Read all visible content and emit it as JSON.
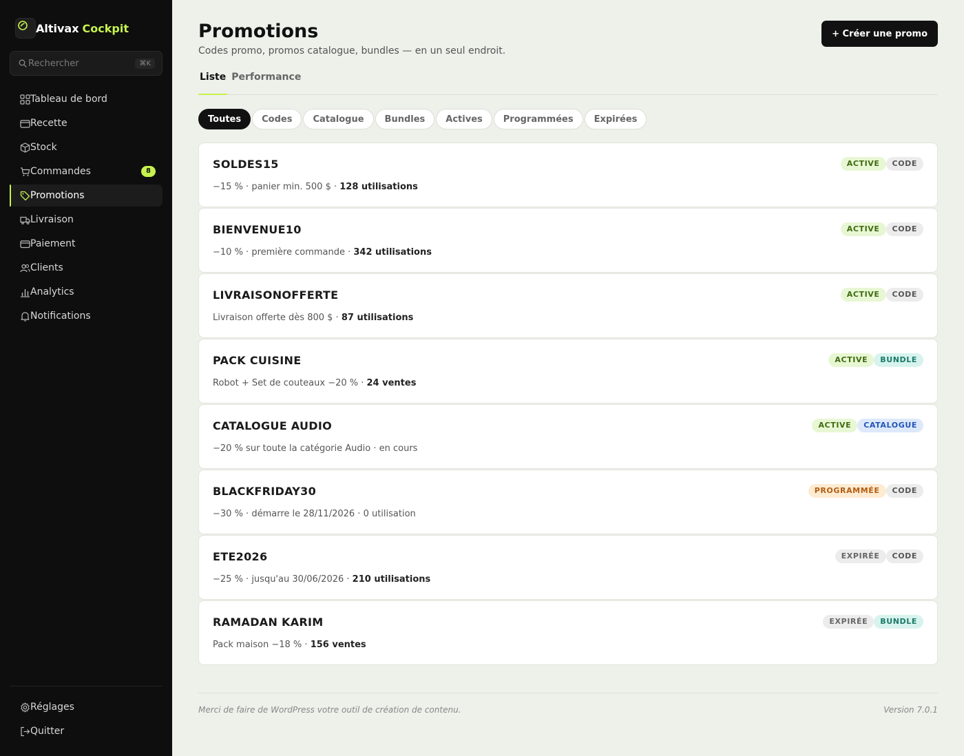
{
  "brand": {
    "name": "Altivax",
    "accent": "Cockpit",
    "icon": "gauge-icon",
    "accent_color": "#c6f24e"
  },
  "search": {
    "placeholder": "Rechercher",
    "shortcut": "⌘K"
  },
  "sidebar": {
    "items": [
      {
        "label": "Tableau de bord",
        "icon": "grid-icon"
      },
      {
        "label": "Recette",
        "icon": "wallet-icon"
      },
      {
        "label": "Stock",
        "icon": "box-icon"
      },
      {
        "label": "Commandes",
        "icon": "cart-icon",
        "badge": "8"
      },
      {
        "label": "Promotions",
        "icon": "tag-icon",
        "active": true
      },
      {
        "label": "Livraison",
        "icon": "truck-icon"
      },
      {
        "label": "Paiement",
        "icon": "credit-card-icon"
      },
      {
        "label": "Clients",
        "icon": "users-icon"
      },
      {
        "label": "Analytics",
        "icon": "bar-chart-icon"
      },
      {
        "label": "Notifications",
        "icon": "bell-icon"
      }
    ],
    "bottom": [
      {
        "label": "Réglages",
        "icon": "gear-icon"
      },
      {
        "label": "Quitter",
        "icon": "logout-icon"
      }
    ]
  },
  "header": {
    "title": "Promotions",
    "subtitle": "Codes promo, promos catalogue, bundles — en un seul endroit.",
    "create_label": "+ Créer une promo"
  },
  "tabs": [
    {
      "label": "Liste",
      "active": true
    },
    {
      "label": "Performance"
    }
  ],
  "filters": [
    {
      "label": "Toutes",
      "active": true
    },
    {
      "label": "Codes"
    },
    {
      "label": "Catalogue"
    },
    {
      "label": "Bundles"
    },
    {
      "label": "Actives"
    },
    {
      "label": "Programmées"
    },
    {
      "label": "Expirées"
    }
  ],
  "promotions": [
    {
      "code": "SOLDES15",
      "desc": "−15 % · panier min. 500 $ · ",
      "stat": "128 utilisations",
      "status": "ACTIVE",
      "type": "CODE"
    },
    {
      "code": "BIENVENUE10",
      "desc": "−10 % · première commande · ",
      "stat": "342 utilisations",
      "status": "ACTIVE",
      "type": "CODE"
    },
    {
      "code": "LIVRAISONOFFERTE",
      "desc": "Livraison offerte dès 800 $ · ",
      "stat": "87 utilisations",
      "status": "ACTIVE",
      "type": "CODE"
    },
    {
      "code": "PACK CUISINE",
      "desc": "Robot + Set de couteaux −20 % · ",
      "stat": "24 ventes",
      "status": "ACTIVE",
      "type": "BUNDLE"
    },
    {
      "code": "CATALOGUE AUDIO",
      "desc": "−20 % sur toute la catégorie Audio · en cours",
      "stat": "",
      "status": "ACTIVE",
      "type": "CATALOGUE"
    },
    {
      "code": "BLACKFRIDAY30",
      "desc": "−30 % · démarre le 28/11/2026 · 0 utilisation",
      "stat": "",
      "status": "PROGRAMMÉE",
      "type": "CODE"
    },
    {
      "code": "ETE2026",
      "desc": "−25 % · jusqu'au 30/06/2026 · ",
      "stat": "210 utilisations",
      "status": "EXPIRÉE",
      "type": "CODE"
    },
    {
      "code": "RAMADAN KARIM",
      "desc": "Pack maison −18 % · ",
      "stat": "156 ventes",
      "status": "EXPIRÉE",
      "type": "BUNDLE"
    }
  ],
  "footer": {
    "left": "Merci de faire de WordPress votre outil de création de contenu.",
    "right": "Version 7.0.1"
  }
}
